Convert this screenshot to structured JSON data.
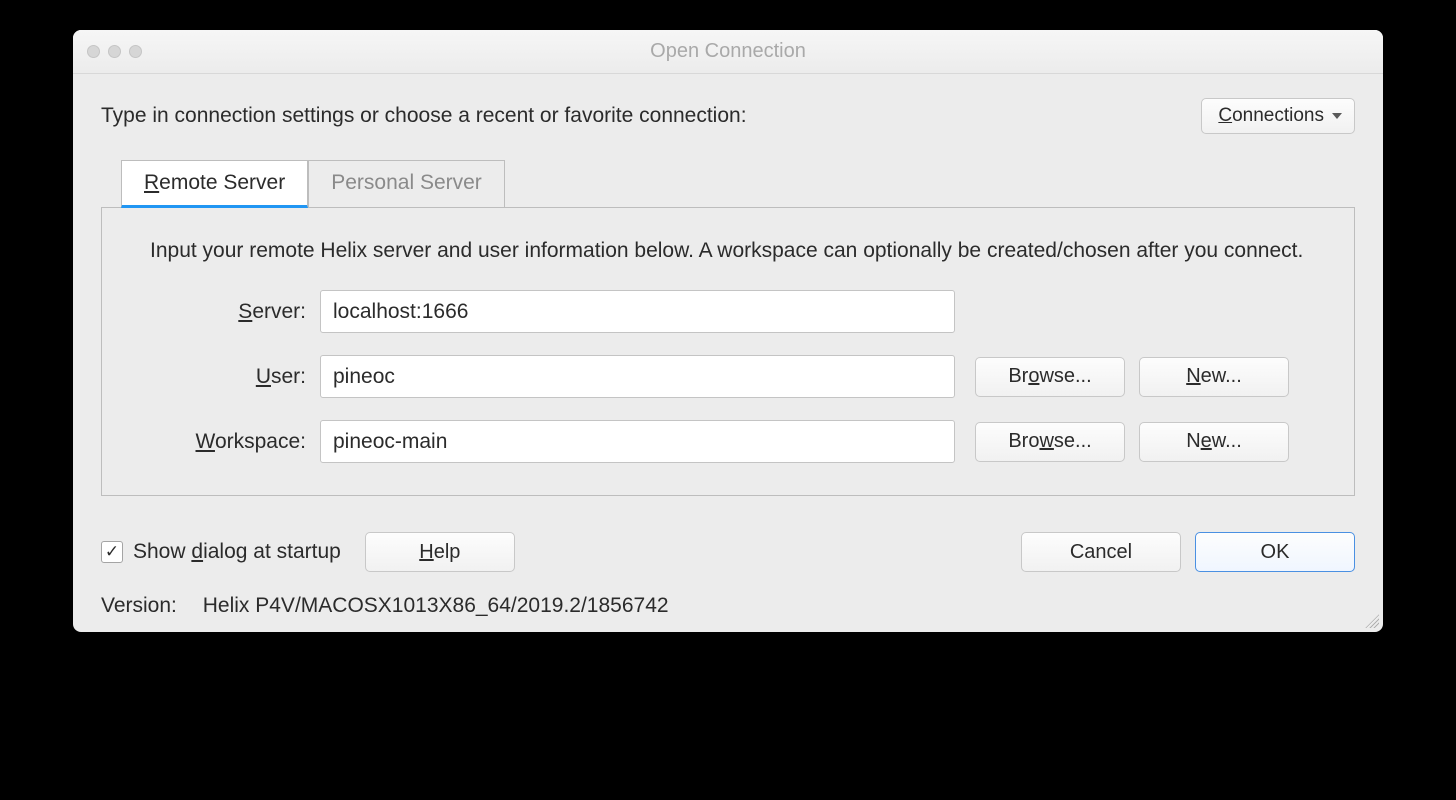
{
  "window": {
    "title": "Open Connection"
  },
  "top": {
    "instruction": "Type in connection settings or choose a recent or favorite connection:",
    "connections_label": "onnections",
    "connections_prefix": "C"
  },
  "tabs": {
    "remote_prefix": "R",
    "remote_rest": "emote Server",
    "personal": "Personal Server"
  },
  "panel": {
    "description": "Input your remote Helix server and user information below. A workspace can optionally be created/chosen after you connect.",
    "server_label_prefix": "S",
    "server_label_rest": "erver:",
    "server_value": "localhost:1666",
    "user_label_prefix": "U",
    "user_label_rest": "ser:",
    "user_value": "pineoc",
    "workspace_label_prefix": "W",
    "workspace_label_rest": "orkspace:",
    "workspace_value": "pineoc-main",
    "browse_user_pre": "Br",
    "browse_user_mn": "o",
    "browse_user_post": "wse...",
    "new_user_pre": "",
    "new_user_mn": "N",
    "new_user_post": "ew...",
    "browse_ws_pre": "Bro",
    "browse_ws_mn": "w",
    "browse_ws_post": "se...",
    "new_ws_pre": "N",
    "new_ws_mn": "e",
    "new_ws_post": "w..."
  },
  "bottom": {
    "checkbox_checked": "✓",
    "checkbox_pre": "Show ",
    "checkbox_mn": "d",
    "checkbox_post": "ialog at startup",
    "help_pre": "",
    "help_mn": "H",
    "help_post": "elp",
    "cancel": "Cancel",
    "ok": "OK"
  },
  "version": {
    "label": "Version:",
    "value": "Helix P4V/MACOSX1013X86_64/2019.2/1856742"
  }
}
